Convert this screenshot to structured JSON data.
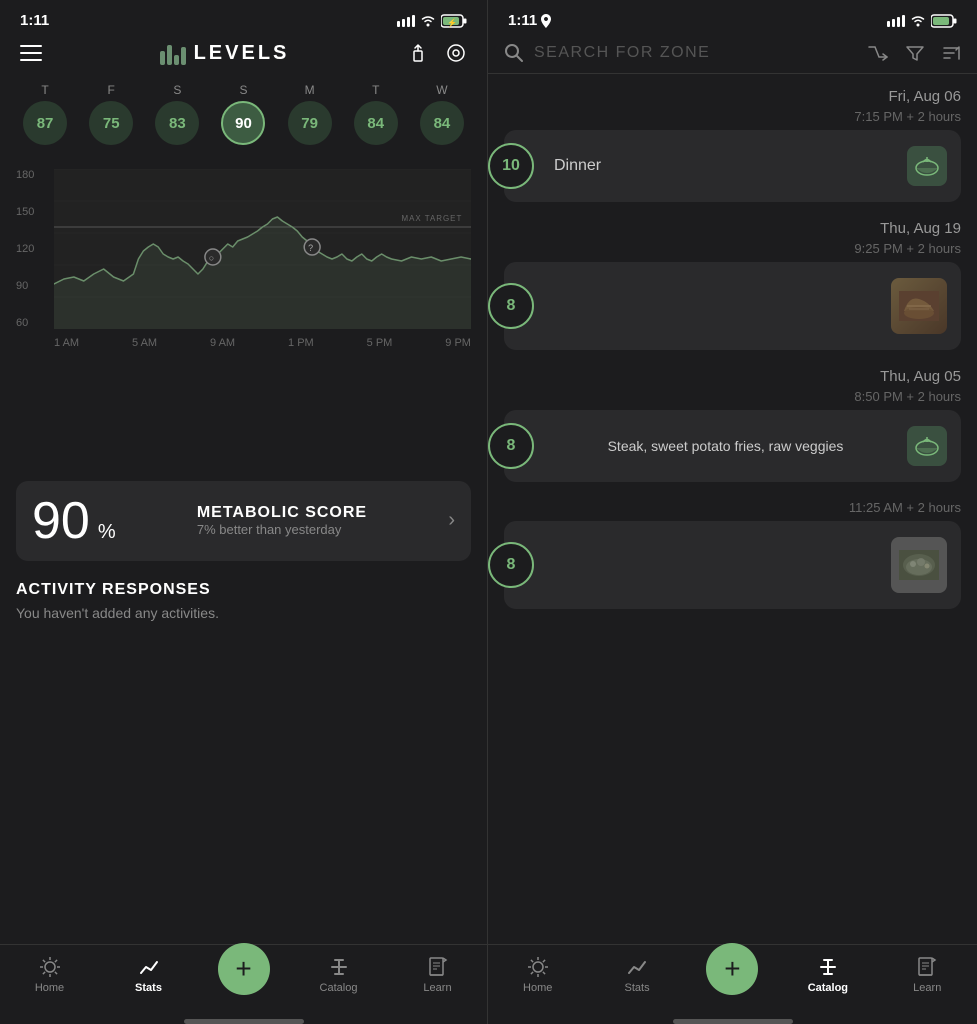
{
  "leftPanel": {
    "statusBar": {
      "time": "1:11",
      "locationIcon": "▶",
      "signalIcon": "▄▄▄",
      "wifiIcon": "wifi",
      "batteryIcon": "🔋"
    },
    "header": {
      "logoText": "LEVELS",
      "shareIcon": "share",
      "settingsIcon": "settings"
    },
    "days": [
      {
        "label": "T",
        "score": 87,
        "active": false
      },
      {
        "label": "F",
        "score": 75,
        "active": false
      },
      {
        "label": "S",
        "score": 83,
        "active": false
      },
      {
        "label": "S",
        "score": 90,
        "active": true
      },
      {
        "label": "M",
        "score": 79,
        "active": false
      },
      {
        "label": "T",
        "score": 84,
        "active": false
      },
      {
        "label": "W",
        "score": 84,
        "active": false
      }
    ],
    "chart": {
      "yLabels": [
        "180",
        "150",
        "120",
        "90",
        "60"
      ],
      "xLabels": [
        "1 AM",
        "5 AM",
        "9 AM",
        "1 PM",
        "5 PM",
        "9 PM"
      ],
      "targetLabel": "MAX TARGET"
    },
    "metabolicScore": {
      "score": "90",
      "percent": "%",
      "title": "METABOLIC SCORE",
      "subtitle": "7% better than yesterday"
    },
    "activityResponses": {
      "title": "ACTIVITY RESPONSES",
      "emptyMessage": "You haven't added any activities."
    },
    "nav": {
      "items": [
        {
          "label": "Home",
          "icon": "☀",
          "active": false
        },
        {
          "label": "Stats",
          "icon": "📈",
          "active": true
        },
        {
          "label": "",
          "icon": "+",
          "isAdd": true
        },
        {
          "label": "Catalog",
          "icon": "✕",
          "active": false
        },
        {
          "label": "Learn",
          "icon": "📖",
          "active": false
        }
      ]
    }
  },
  "rightPanel": {
    "statusBar": {
      "time": "1:11",
      "locationIcon": "▶"
    },
    "search": {
      "placeholder": "SEARCH FOR ZONE",
      "filterIcon": "filter",
      "sortIcon": "sort",
      "routeIcon": "route"
    },
    "zoneEntries": [
      {
        "dateHeader": "Fri, Aug 06",
        "time": "7:15 PM + 2 hours",
        "score": 10,
        "label": "Dinner",
        "hasIcon": true,
        "hasImage": false
      },
      {
        "dateHeader": "Thu, Aug 19",
        "time": "9:25 PM + 2 hours",
        "score": 8,
        "label": "",
        "hasIcon": false,
        "hasImage": true,
        "imageType": "food1"
      },
      {
        "dateHeader": "Thu, Aug 05",
        "time": "8:50 PM + 2 hours",
        "score": 8,
        "label": "Steak, sweet potato fries, raw veggies",
        "hasIcon": true,
        "hasImage": false
      },
      {
        "dateHeader": "",
        "time": "11:25 AM + 2 hours",
        "score": 8,
        "label": "",
        "hasIcon": false,
        "hasImage": true,
        "imageType": "food2"
      }
    ],
    "nav": {
      "items": [
        {
          "label": "Home",
          "icon": "☀",
          "active": false
        },
        {
          "label": "Stats",
          "icon": "📈",
          "active": false
        },
        {
          "label": "",
          "icon": "+",
          "isAdd": true
        },
        {
          "label": "Catalog",
          "icon": "✕",
          "active": true
        },
        {
          "label": "Learn",
          "icon": "📖",
          "active": false
        }
      ]
    }
  }
}
